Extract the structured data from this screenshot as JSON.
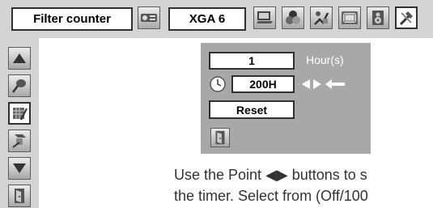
{
  "menu": {
    "title": "Filter counter",
    "input_source": "XGA 6",
    "top_icons": [
      "computer-icon",
      "color-adjust-icon",
      "image-adjust-icon",
      "screen-icon",
      "sound-icon",
      "setting-icon"
    ]
  },
  "sidebar": {
    "items": [
      "up-arrow-icon",
      "pin-icon",
      "filter-icon",
      "filter-counter-icon",
      "down-arrow-icon",
      "exit-icon"
    ]
  },
  "panel": {
    "hours_value": "1",
    "hours_unit": "Hour(s)",
    "timer_value": "200H",
    "reset_label": "Reset"
  },
  "description": {
    "line1": "Use the Point ◀▶ buttons to s",
    "line2": "the timer. Select from (Off/100"
  }
}
